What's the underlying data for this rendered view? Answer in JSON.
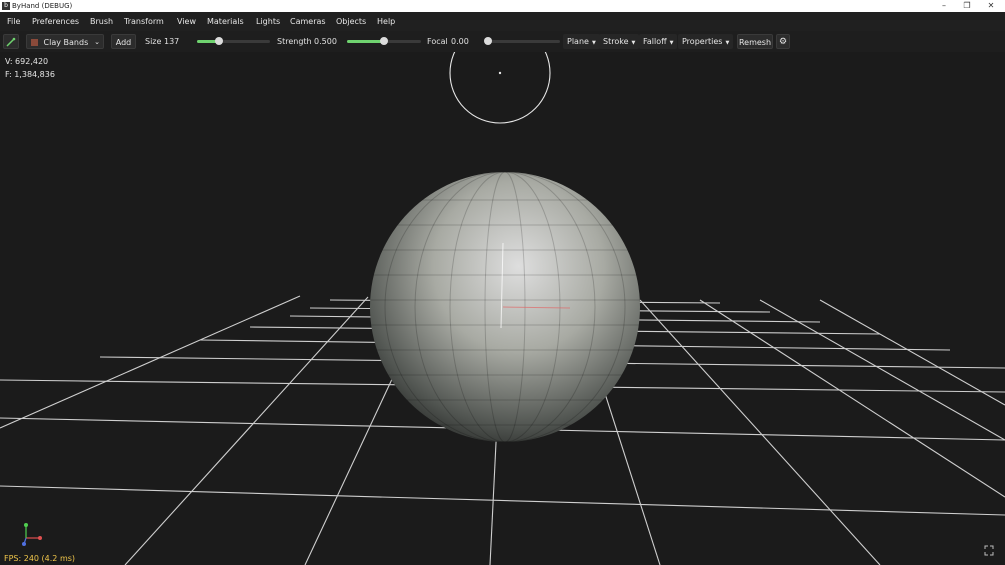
{
  "window": {
    "title": "ByHand (DEBUG)",
    "app_icon_glyph": "b",
    "controls": {
      "minimize": "–",
      "restore": "❐",
      "close": "✕"
    }
  },
  "menu": [
    "File",
    "Preferences",
    "Brush",
    "Transform",
    "View",
    "Materials",
    "Lights",
    "Cameras",
    "Objects",
    "Help"
  ],
  "toolbar": {
    "brush_tool_icon": "sculpt-brush-icon",
    "brush_name": "Clay Bands",
    "add_label": "Add",
    "size_label": "Size",
    "size_value": "137",
    "size_fraction": 0.3,
    "strength_label": "Strength",
    "strength_value": "0.500",
    "strength_fraction": 0.5,
    "focal_label": "Focal",
    "focal_value": "0.00",
    "focal_fraction": 0.0,
    "plane_label": "Plane",
    "stroke_label": "Stroke",
    "falloff_label": "Falloff",
    "properties_label": "Properties",
    "remesh_label": "Remesh",
    "settings_icon": "gear-icon"
  },
  "stats": {
    "vertices": "V:  692,420",
    "faces": "F:  1,384,836",
    "fps": "FPS: 240  (4.2 ms)"
  },
  "colors": {
    "accent": "#6fd36f",
    "fps": "#f0c64a",
    "axis_x": "#e05050",
    "axis_y": "#50d050",
    "axis_z": "#5070e0"
  }
}
